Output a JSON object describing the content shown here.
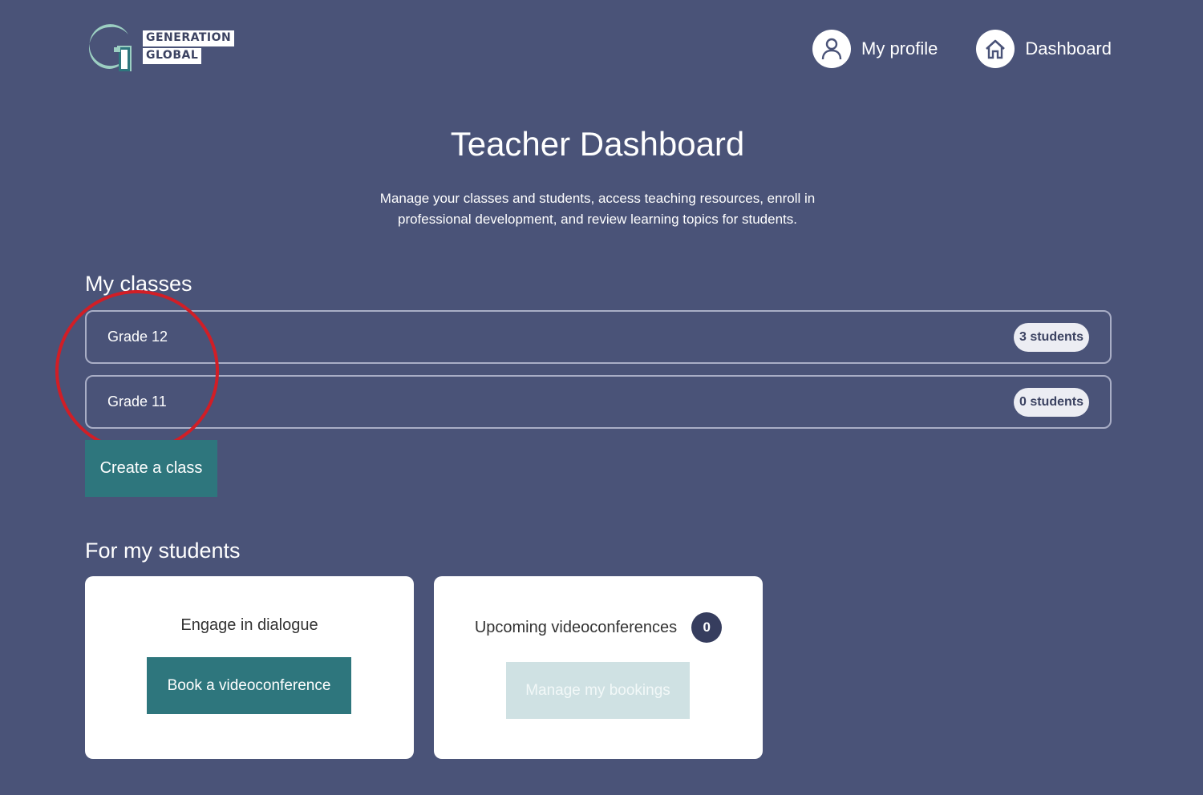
{
  "header": {
    "logo": {
      "word_1": "GENERATION",
      "word_2": "GLOBAL",
      "mark_letter": "G",
      "colors": {
        "mark_green": "#9ccfc2",
        "mark_teal": "#2e767d",
        "mark_white": "#ffffff"
      }
    },
    "nav": [
      {
        "label": "My profile",
        "icon": "user-icon"
      },
      {
        "label": "Dashboard",
        "icon": "home-icon"
      }
    ]
  },
  "page": {
    "title": "Teacher Dashboard",
    "intro_line_1": "Manage your classes and students, access teaching resources, enroll in",
    "intro_line_2": "professional development, and review learning topics for students."
  },
  "my_classes": {
    "heading": "My classes",
    "classes": [
      {
        "name": "Grade 12",
        "students": "3 students"
      },
      {
        "name": "Grade 11",
        "students": "0 students"
      }
    ],
    "create_label": "Create a class"
  },
  "for_my_students": {
    "heading": "For my students",
    "cards": [
      {
        "title": "Engage in dialogue",
        "button": "Book a videoconference"
      },
      {
        "title": "Upcoming videoconferences",
        "count": "0",
        "button": "Manage my bookings"
      }
    ]
  },
  "colors": {
    "background": "#4a5378",
    "primary_button": "#2e767d",
    "disabled_button": "#cfe1e3",
    "annotation": "#d11e26",
    "badge_dark": "#363d5e"
  }
}
